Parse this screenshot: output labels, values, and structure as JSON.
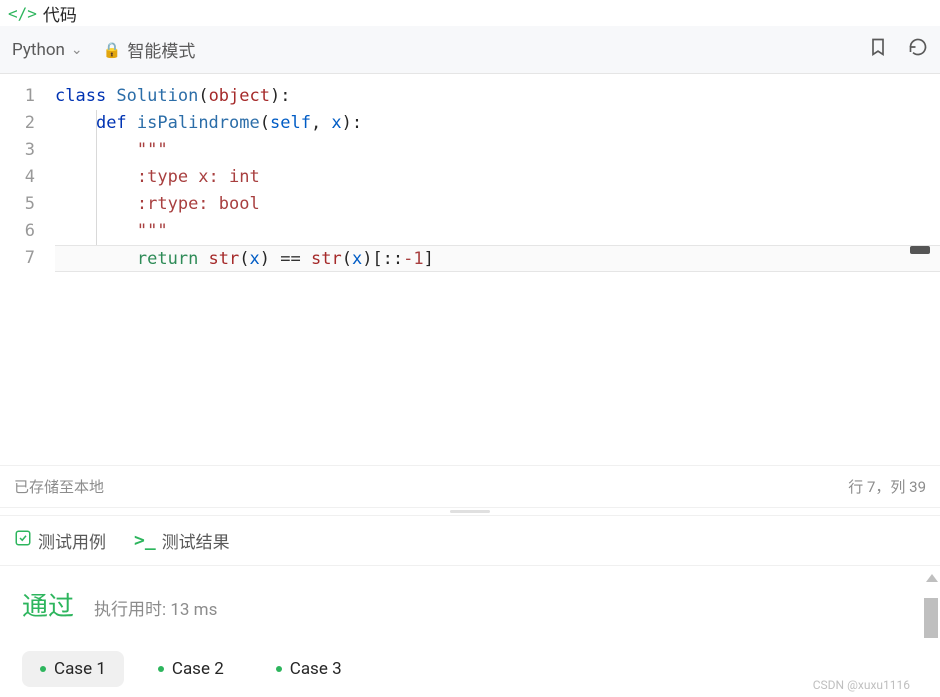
{
  "header": {
    "title": "代码"
  },
  "toolbar": {
    "language": "Python",
    "mode": "智能模式"
  },
  "code": {
    "lines": [
      "1",
      "2",
      "3",
      "4",
      "5",
      "6",
      "7"
    ],
    "l1_class": "class ",
    "l1_clsname": "Solution",
    "l1_open": "(",
    "l1_obj": "object",
    "l1_close": "):",
    "l2_def": "def ",
    "l2_fn": "isPalindrome",
    "l2_open": "(",
    "l2_self": "self",
    "l2_comma": ", ",
    "l2_x": "x",
    "l2_close": "):",
    "l3_doc": "\"\"\"",
    "l4_doc": ":type x: int",
    "l5_doc": ":rtype: bool",
    "l6_doc": "\"\"\"",
    "l7_return": "return ",
    "l7_str1": "str",
    "l7_p1": "(",
    "l7_x1": "x",
    "l7_p2": ") ",
    "l7_eq": "== ",
    "l7_str2": "str",
    "l7_p3": "(",
    "l7_x2": "x",
    "l7_p4": ")[::",
    "l7_neg1": "-1",
    "l7_p5": "]"
  },
  "status": {
    "saved": "已存储至本地",
    "cursor": "行 7，列 39"
  },
  "tabs": {
    "testcase": "测试用例",
    "result": "测试结果"
  },
  "result": {
    "status": "通过",
    "runtime": "执行用时: 13 ms",
    "cases": [
      {
        "label": "Case 1",
        "active": true
      },
      {
        "label": "Case 2",
        "active": false
      },
      {
        "label": "Case 3",
        "active": false
      }
    ]
  },
  "watermark": "CSDN @xuxu1116"
}
